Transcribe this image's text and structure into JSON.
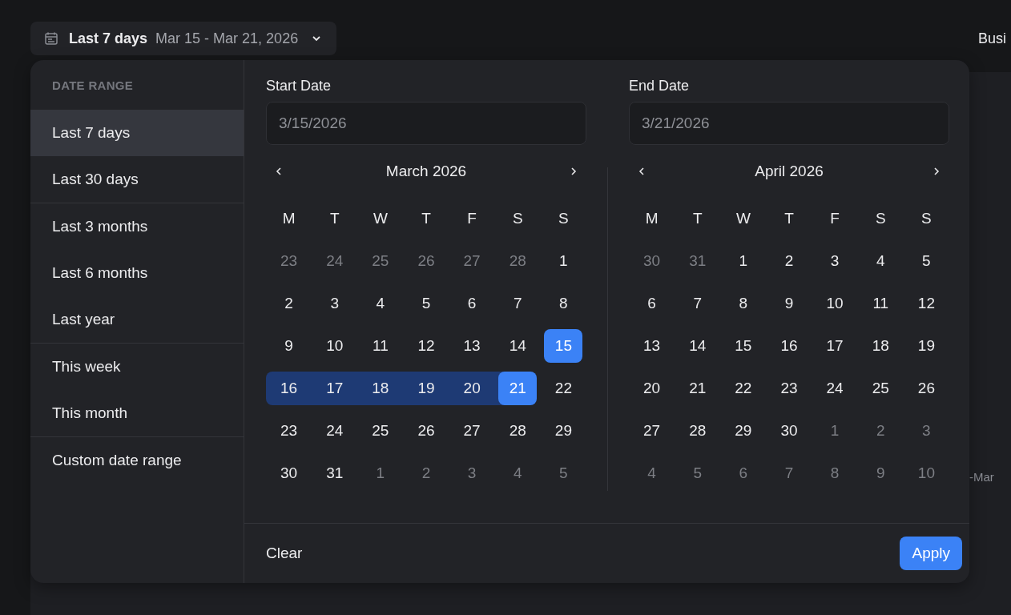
{
  "trigger": {
    "label": "Last 7 days",
    "range": "Mar 15 - Mar 21, 2026"
  },
  "header_right": "Busi",
  "background_axis_label": "-Mar",
  "sidebar": {
    "title": "DATE RANGE",
    "groups": [
      {
        "items": [
          {
            "label": "Last 7 days",
            "selected": true
          },
          {
            "label": "Last 30 days",
            "selected": false
          }
        ]
      },
      {
        "items": [
          {
            "label": "Last 3 months",
            "selected": false
          },
          {
            "label": "Last 6 months",
            "selected": false
          },
          {
            "label": "Last year",
            "selected": false
          }
        ]
      },
      {
        "items": [
          {
            "label": "This week",
            "selected": false
          },
          {
            "label": "This month",
            "selected": false
          }
        ]
      },
      {
        "items": [
          {
            "label": "Custom date range",
            "selected": false
          }
        ]
      }
    ]
  },
  "start_date": {
    "label": "Start Date",
    "value": "3/15/2026"
  },
  "end_date": {
    "label": "End Date",
    "value": "3/21/2026"
  },
  "calendars": [
    {
      "title": "March 2026",
      "weekdays": [
        "M",
        "T",
        "W",
        "T",
        "F",
        "S",
        "S"
      ],
      "weeks": [
        [
          {
            "day": "23",
            "kind": "outside"
          },
          {
            "day": "24",
            "kind": "outside"
          },
          {
            "day": "25",
            "kind": "outside"
          },
          {
            "day": "26",
            "kind": "outside"
          },
          {
            "day": "27",
            "kind": "outside"
          },
          {
            "day": "28",
            "kind": "outside"
          },
          {
            "day": "1",
            "kind": "normal"
          }
        ],
        [
          {
            "day": "2",
            "kind": "normal"
          },
          {
            "day": "3",
            "kind": "normal"
          },
          {
            "day": "4",
            "kind": "normal"
          },
          {
            "day": "5",
            "kind": "normal"
          },
          {
            "day": "6",
            "kind": "normal"
          },
          {
            "day": "7",
            "kind": "normal"
          },
          {
            "day": "8",
            "kind": "normal"
          }
        ],
        [
          {
            "day": "9",
            "kind": "normal"
          },
          {
            "day": "10",
            "kind": "normal"
          },
          {
            "day": "11",
            "kind": "normal"
          },
          {
            "day": "12",
            "kind": "normal"
          },
          {
            "day": "13",
            "kind": "normal"
          },
          {
            "day": "14",
            "kind": "normal"
          },
          {
            "day": "15",
            "kind": "start"
          }
        ],
        [
          {
            "day": "16",
            "kind": "range_first"
          },
          {
            "day": "17",
            "kind": "range"
          },
          {
            "day": "18",
            "kind": "range"
          },
          {
            "day": "19",
            "kind": "range"
          },
          {
            "day": "20",
            "kind": "range"
          },
          {
            "day": "21",
            "kind": "end"
          },
          {
            "day": "22",
            "kind": "normal"
          }
        ],
        [
          {
            "day": "23",
            "kind": "normal"
          },
          {
            "day": "24",
            "kind": "normal"
          },
          {
            "day": "25",
            "kind": "normal"
          },
          {
            "day": "26",
            "kind": "normal"
          },
          {
            "day": "27",
            "kind": "normal"
          },
          {
            "day": "28",
            "kind": "normal"
          },
          {
            "day": "29",
            "kind": "normal"
          }
        ],
        [
          {
            "day": "30",
            "kind": "normal"
          },
          {
            "day": "31",
            "kind": "normal"
          },
          {
            "day": "1",
            "kind": "outside"
          },
          {
            "day": "2",
            "kind": "outside"
          },
          {
            "day": "3",
            "kind": "outside"
          },
          {
            "day": "4",
            "kind": "outside"
          },
          {
            "day": "5",
            "kind": "outside"
          }
        ]
      ]
    },
    {
      "title": "April 2026",
      "weekdays": [
        "M",
        "T",
        "W",
        "T",
        "F",
        "S",
        "S"
      ],
      "weeks": [
        [
          {
            "day": "30",
            "kind": "outside"
          },
          {
            "day": "31",
            "kind": "outside"
          },
          {
            "day": "1",
            "kind": "normal"
          },
          {
            "day": "2",
            "kind": "normal"
          },
          {
            "day": "3",
            "kind": "normal"
          },
          {
            "day": "4",
            "kind": "normal"
          },
          {
            "day": "5",
            "kind": "normal"
          }
        ],
        [
          {
            "day": "6",
            "kind": "normal"
          },
          {
            "day": "7",
            "kind": "normal"
          },
          {
            "day": "8",
            "kind": "normal"
          },
          {
            "day": "9",
            "kind": "normal"
          },
          {
            "day": "10",
            "kind": "normal"
          },
          {
            "day": "11",
            "kind": "normal"
          },
          {
            "day": "12",
            "kind": "normal"
          }
        ],
        [
          {
            "day": "13",
            "kind": "normal"
          },
          {
            "day": "14",
            "kind": "normal"
          },
          {
            "day": "15",
            "kind": "normal"
          },
          {
            "day": "16",
            "kind": "normal"
          },
          {
            "day": "17",
            "kind": "normal"
          },
          {
            "day": "18",
            "kind": "normal"
          },
          {
            "day": "19",
            "kind": "normal"
          }
        ],
        [
          {
            "day": "20",
            "kind": "normal"
          },
          {
            "day": "21",
            "kind": "normal"
          },
          {
            "day": "22",
            "kind": "normal"
          },
          {
            "day": "23",
            "kind": "normal"
          },
          {
            "day": "24",
            "kind": "normal"
          },
          {
            "day": "25",
            "kind": "normal"
          },
          {
            "day": "26",
            "kind": "normal"
          }
        ],
        [
          {
            "day": "27",
            "kind": "normal"
          },
          {
            "day": "28",
            "kind": "normal"
          },
          {
            "day": "29",
            "kind": "normal"
          },
          {
            "day": "30",
            "kind": "normal"
          },
          {
            "day": "1",
            "kind": "outside"
          },
          {
            "day": "2",
            "kind": "outside"
          },
          {
            "day": "3",
            "kind": "outside"
          }
        ],
        [
          {
            "day": "4",
            "kind": "outside"
          },
          {
            "day": "5",
            "kind": "outside"
          },
          {
            "day": "6",
            "kind": "outside"
          },
          {
            "day": "7",
            "kind": "outside"
          },
          {
            "day": "8",
            "kind": "outside"
          },
          {
            "day": "9",
            "kind": "outside"
          },
          {
            "day": "10",
            "kind": "outside"
          }
        ]
      ]
    }
  ],
  "buttons": {
    "clear": "Clear",
    "apply": "Apply"
  }
}
